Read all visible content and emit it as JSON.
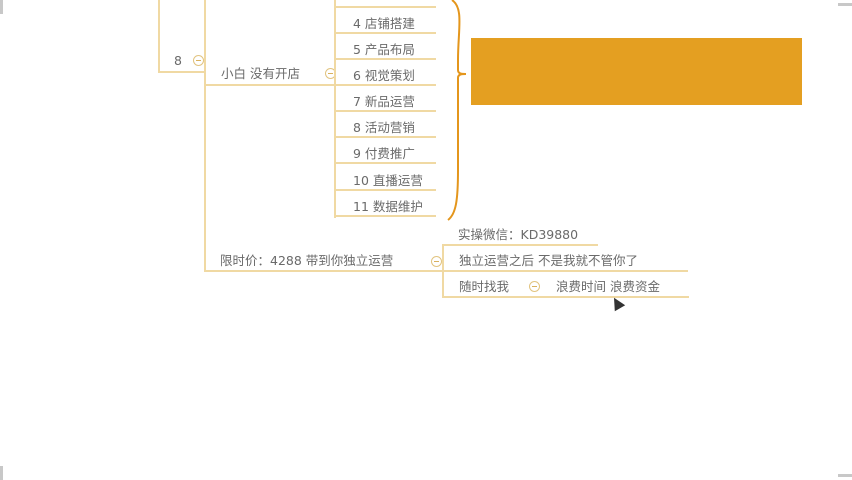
{
  "node_8": {
    "label": "8"
  },
  "node_xiaobai": {
    "label": "小白 没有开店"
  },
  "steps": [
    {
      "label": "4 店铺搭建"
    },
    {
      "label": "5 产品布局"
    },
    {
      "label": "6 视觉策划"
    },
    {
      "label": "7 新品运营"
    },
    {
      "label": "8 活动营销"
    },
    {
      "label": "9 付费推广"
    },
    {
      "label": "10 直播运营"
    },
    {
      "label": "11 数据维护"
    }
  ],
  "price_node": {
    "label": "限时价：4288 带到你独立运营"
  },
  "wechat": {
    "label": "实操微信：KD39880"
  },
  "after": {
    "label": "独立运营之后 不是我就不管你了"
  },
  "anytime": {
    "label": "随时找我"
  },
  "waste": {
    "label": "浪费时间 浪费资金"
  },
  "colors": {
    "banner": "#e49f21",
    "bracket": "#e4961c",
    "branch_line": "#f0d9a3",
    "text": "#6a6a6a"
  }
}
